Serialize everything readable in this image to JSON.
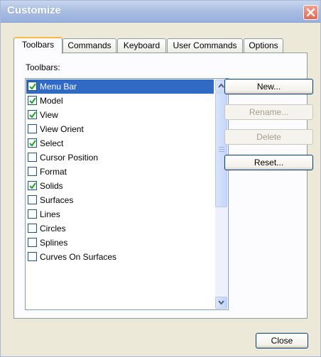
{
  "window": {
    "title": "Customize"
  },
  "tabs": [
    {
      "label": "Toolbars",
      "active": true
    },
    {
      "label": "Commands",
      "active": false
    },
    {
      "label": "Keyboard",
      "active": false
    },
    {
      "label": "User Commands",
      "active": false
    },
    {
      "label": "Options",
      "active": false
    }
  ],
  "toolbars_section": {
    "label": "Toolbars:",
    "items": [
      {
        "label": "Menu Bar",
        "checked": true,
        "selected": true
      },
      {
        "label": "Model",
        "checked": true,
        "selected": false
      },
      {
        "label": "View",
        "checked": true,
        "selected": false
      },
      {
        "label": "View Orient",
        "checked": false,
        "selected": false
      },
      {
        "label": "Select",
        "checked": true,
        "selected": false
      },
      {
        "label": "Cursor Position",
        "checked": false,
        "selected": false
      },
      {
        "label": "Format",
        "checked": false,
        "selected": false
      },
      {
        "label": "Solids",
        "checked": true,
        "selected": false
      },
      {
        "label": "Surfaces",
        "checked": false,
        "selected": false
      },
      {
        "label": "Lines",
        "checked": false,
        "selected": false
      },
      {
        "label": "Circles",
        "checked": false,
        "selected": false
      },
      {
        "label": "Splines",
        "checked": false,
        "selected": false
      },
      {
        "label": "Curves On Surfaces",
        "checked": false,
        "selected": false
      }
    ]
  },
  "buttons": {
    "new": "New...",
    "rename": "Rename...",
    "delete": "Delete",
    "reset": "Reset...",
    "close": "Close"
  },
  "colors": {
    "selection": "#316ac5",
    "accent_tab": "#f6b846",
    "close_button": "#e0694f"
  }
}
